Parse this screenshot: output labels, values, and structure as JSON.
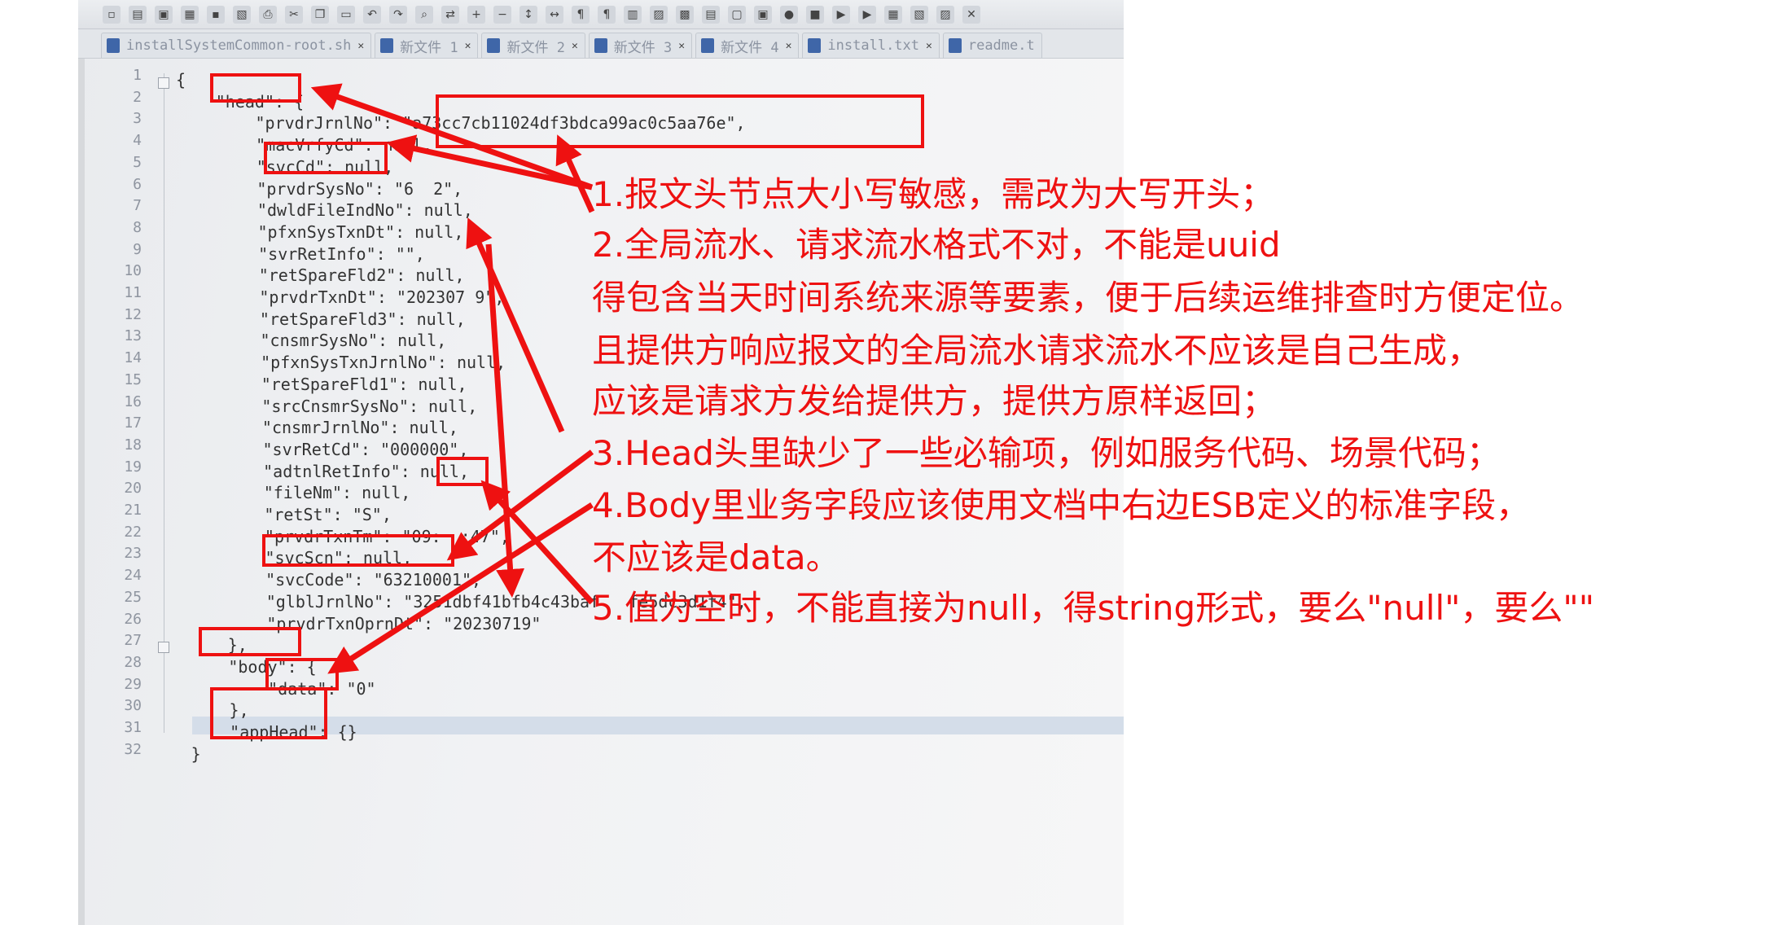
{
  "toolbar": {
    "icons": [
      "new-file-icon",
      "open-icon",
      "save-icon",
      "save-all-icon",
      "close-icon",
      "close-all-icon",
      "print-icon",
      "cut-icon",
      "copy-icon",
      "paste-icon",
      "undo-icon",
      "redo-icon",
      "find-icon",
      "replace-icon",
      "zoom-in-icon",
      "zoom-out-icon",
      "sync-v-icon",
      "sync-h-icon",
      "wrap-icon",
      "all-chars-icon",
      "indent-guide-icon",
      "udl-icon",
      "doc-map-icon",
      "func-list-icon",
      "folder-workspace-icon",
      "monitor-icon",
      "record-macro-icon",
      "stop-macro-icon",
      "play-macro-icon",
      "run-macro-multi-icon",
      "save-macro-icon",
      "lang-icon",
      "spell-icon",
      "close-x-icon"
    ]
  },
  "tabs": [
    {
      "label": "installSystemCommon-root.sh"
    },
    {
      "label": "新文件 1"
    },
    {
      "label": "新文件 2"
    },
    {
      "label": "新文件 3"
    },
    {
      "label": "新文件 4"
    },
    {
      "label": "install.txt"
    },
    {
      "label": "readme.t"
    }
  ],
  "editor": {
    "line_numbers": [
      "1",
      "2",
      "3",
      "4",
      "5",
      "6",
      "7",
      "8",
      "9",
      "10",
      "11",
      "12",
      "13",
      "14",
      "15",
      "16",
      "17",
      "18",
      "19",
      "20",
      "21",
      "22",
      "23",
      "24",
      "25",
      "26",
      "27",
      "28",
      "29",
      "30",
      "31",
      "32"
    ],
    "lines": [
      {
        "text": "{"
      },
      {
        "text": "    \"head\": {"
      },
      {
        "text": "        \"prvdrJrnlNo\": \"a73cc7cb11024df3bdca99ac0c5aa76e\","
      },
      {
        "text": "        \"macVrfyCd\": null,"
      },
      {
        "text": "        \"svcCd\": null,"
      },
      {
        "text": "        \"prvdrSysNo\": \"6  2\","
      },
      {
        "text": "        \"dwldFileIndNo\": null,"
      },
      {
        "text": "        \"pfxnSysTxnDt\": null,"
      },
      {
        "text": "        \"svrRetInfo\": \"\","
      },
      {
        "text": "        \"retSpareFld2\": null,"
      },
      {
        "text": "        \"prvdrTxnDt\": \"202307 9\","
      },
      {
        "text": "        \"retSpareFld3\": null,"
      },
      {
        "text": "        \"cnsmrSysNo\": null,"
      },
      {
        "text": "        \"pfxnSysTxnJrnlNo\": null,"
      },
      {
        "text": "        \"retSpareFld1\": null,"
      },
      {
        "text": "        \"srcCnsmrSysNo\": null,"
      },
      {
        "text": "        \"cnsmrJrnlNo\": null,"
      },
      {
        "text": "        \"svrRetCd\": \"000000\","
      },
      {
        "text": "        \"adtnlRetInfo\": null,"
      },
      {
        "text": "        \"fileNm\": null,"
      },
      {
        "text": "        \"retSt\": \"S\","
      },
      {
        "text": "        \"prvdrTxnTm\": \"09:  :47\","
      },
      {
        "text": "        \"svcScn\": null,"
      },
      {
        "text": "        \"svcCode\": \"63210001\","
      },
      {
        "text": "        \"glblJrnlNo\": \"3251dbf41bfb4c43baf   fe5dc3d1f4\","
      },
      {
        "text": "        \"prvdrTxnOprnDt\": \"20230719\""
      },
      {
        "text": "    },"
      },
      {
        "text": "    \"body\": {"
      },
      {
        "text": "        \"data\": \"0\""
      },
      {
        "text": "    },"
      },
      {
        "text": "    \"appHead\": {}"
      },
      {
        "text": "}"
      }
    ]
  },
  "annotations": [
    {
      "text": "1.报文头节点大小写敏感，需改为大写开头；"
    },
    {
      "text": "2.全局流水、请求流水格式不对，不能是uuid"
    },
    {
      "text": "得包含当天时间系统来源等要素，便于后续运维排查时方便定位。"
    },
    {
      "text": "且提供方响应报文的全局流水请求流水不应该是自己生成，"
    },
    {
      "text": "应该是请求方发给提供方，提供方原样返回；"
    },
    {
      "text": "3.Head头里缺少了一些必输项，例如服务代码、场景代码；"
    },
    {
      "text": "4.Body里业务字段应该使用文档中右边ESB定义的标准字段，"
    },
    {
      "text": "不应该是data。"
    },
    {
      "text": "5.值为空时，不能直接为null，得string形式，要么\"null\"，要么\"\""
    }
  ],
  "colors": {
    "annotation": "#ee1111",
    "code_key": "#2c4a7e",
    "editor_bg": "#f1f2f4"
  }
}
